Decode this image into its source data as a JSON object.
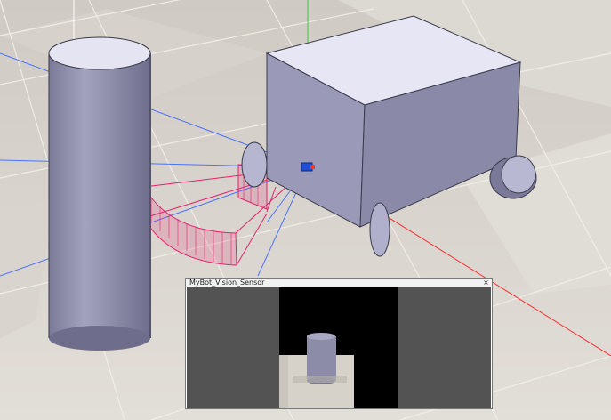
{
  "viewport": {
    "floor_colors": [
      "#d9d6d0",
      "#c8c4bd",
      "#e3e0da"
    ],
    "axis_colors": {
      "x": "#ff2a2a",
      "y": "#2ad62a",
      "z": "#3a6bff"
    },
    "proximity_sensor_color": "#e8206f",
    "cylinder_color": "#9898b4",
    "robot_body_color": "#9a9ab8"
  },
  "sensor_window": {
    "title": "MyBot_Vision_Sensor",
    "close_label": "×",
    "image_colors": {
      "background_gray": "#535353",
      "black": "#000000",
      "floor": "#d6d2ca",
      "cylinder": "#8c8ca8"
    }
  }
}
